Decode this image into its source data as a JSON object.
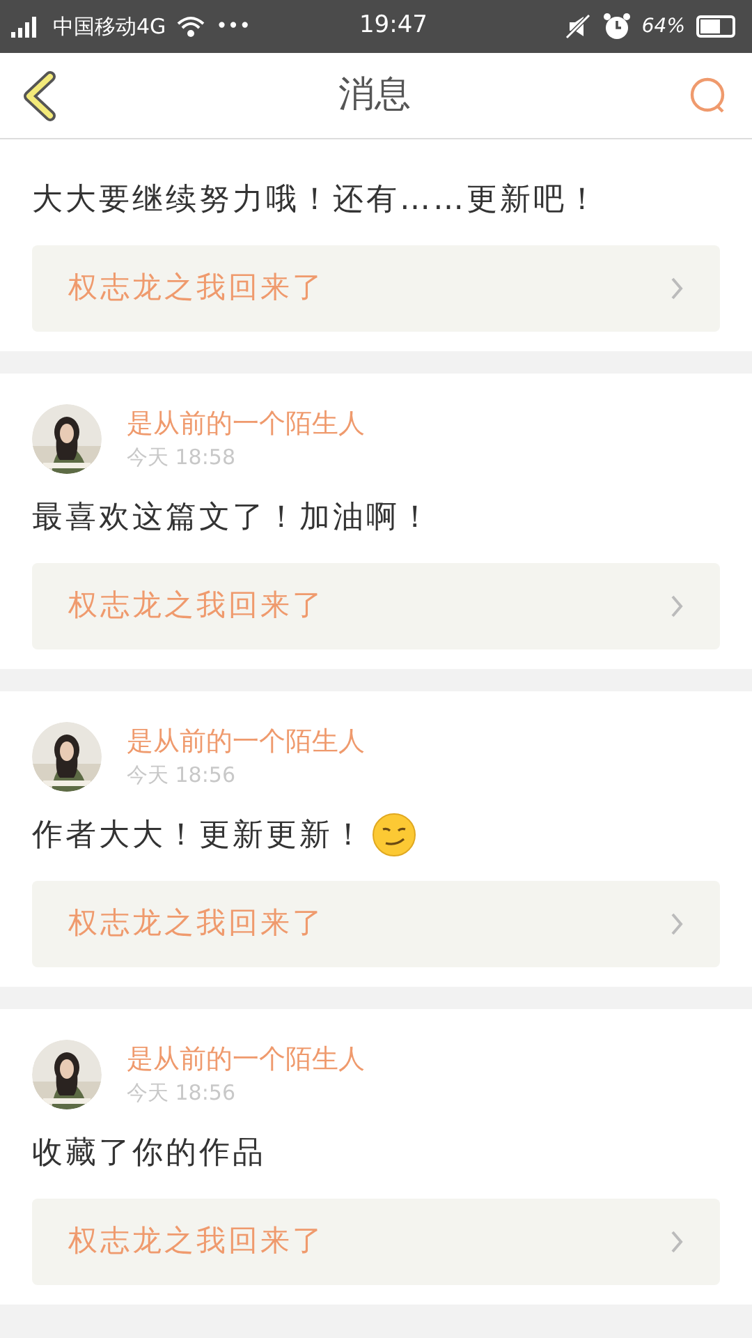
{
  "status_bar": {
    "carrier": "中国移动4G",
    "more": "•••",
    "time": "19:47",
    "battery_text": "64%"
  },
  "header": {
    "title": "消息"
  },
  "messages": [
    {
      "kind": "text",
      "comment": "大大要继续努力哦！还有……更新吧！",
      "work_title": "权志龙之我回来了"
    },
    {
      "kind": "text",
      "user": "是从前的一个陌生人",
      "time": "今天 18:58",
      "comment": "最喜欢这篇文了！加油啊！",
      "work_title": "权志龙之我回来了"
    },
    {
      "kind": "emoji",
      "user": "是从前的一个陌生人",
      "time": "今天 18:56",
      "comment": "作者大大！更新更新！",
      "work_title": "权志龙之我回来了"
    },
    {
      "kind": "text",
      "user": "是从前的一个陌生人",
      "time": "今天 18:56",
      "comment": "收藏了你的作品",
      "work_title": "权志龙之我回来了"
    }
  ]
}
